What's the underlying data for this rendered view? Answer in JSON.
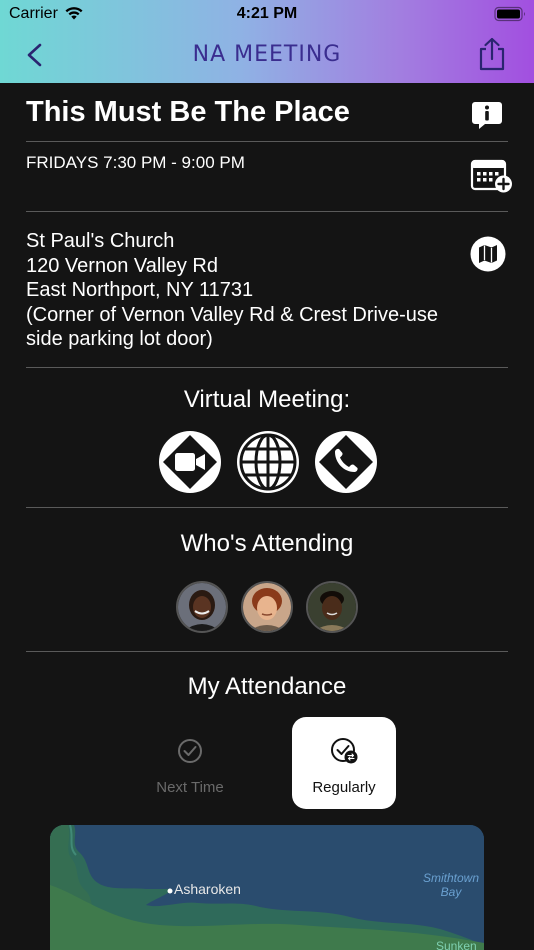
{
  "status_bar": {
    "carrier": "Carrier",
    "time": "4:21 PM"
  },
  "nav": {
    "title": "NA MEETING",
    "back_icon": "chevron-left-icon",
    "share_icon": "share-icon"
  },
  "meeting": {
    "name": "This Must Be The Place",
    "schedule": "FRIDAYS 7:30 PM - 9:00 PM",
    "address_lines": [
      "St Paul's Church",
      "120 Vernon Valley Rd",
      "East Northport, NY 11731",
      "(Corner of Vernon Valley Rd & Crest Drive-use",
      "side parking lot door)"
    ]
  },
  "virtual": {
    "label": "Virtual Meeting:",
    "icons": [
      "video-call-icon",
      "globe-icon",
      "phone-call-icon"
    ]
  },
  "attending": {
    "label": "Who's Attending"
  },
  "attendance": {
    "label": "My Attendance",
    "options": [
      {
        "label": "Next Time",
        "selected": false
      },
      {
        "label": "Regularly",
        "selected": true
      }
    ]
  },
  "map": {
    "labels": [
      "Asharoken",
      "Sunken"
    ],
    "water_labels": [
      "Smithtown Bay"
    ],
    "water_label_lines": [
      "Smithtown",
      "Bay"
    ]
  },
  "colors": {
    "background": "#141414",
    "header_gradient": [
      "#6fd8d4",
      "#a24fe0"
    ],
    "nav_title": "#3a2d8f",
    "divider": "#5a5a5a"
  }
}
